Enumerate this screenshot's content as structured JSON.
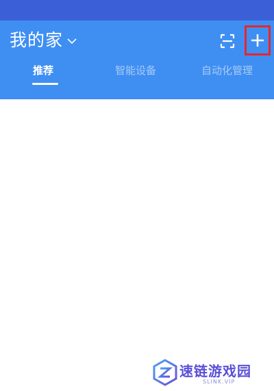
{
  "header": {
    "home_name": "我的家",
    "scan_icon": "scan-icon",
    "add_icon": "plus-icon",
    "highlight_color": "#e8262a",
    "background_color": "#3f8ff2"
  },
  "tabs": [
    {
      "label": "推荐",
      "active": true
    },
    {
      "label": "智能设备",
      "active": false
    },
    {
      "label": "自动化管理",
      "active": false
    }
  ],
  "watermark": {
    "text": "速链游戏园",
    "subtext": "SLINK.VIP"
  }
}
